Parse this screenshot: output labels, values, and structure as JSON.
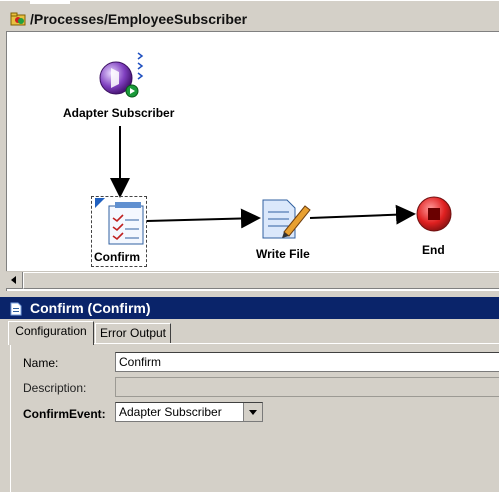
{
  "process": {
    "path": "/Processes/EmployeeSubscriber"
  },
  "canvas": {
    "nodes": [
      {
        "id": "adapter-subscriber",
        "label": "Adapter Subscriber",
        "icon": "adapter-subscriber-icon"
      },
      {
        "id": "confirm",
        "label": "Confirm",
        "icon": "confirm-icon",
        "selected": true
      },
      {
        "id": "write-file",
        "label": "Write File",
        "icon": "write-file-icon"
      },
      {
        "id": "end",
        "label": "End",
        "icon": "end-icon"
      }
    ]
  },
  "panel": {
    "title": "Confirm (Confirm)",
    "tabs": [
      {
        "label": "Configuration",
        "active": true
      },
      {
        "label": "Error Output",
        "active": false
      }
    ],
    "fields": {
      "name": {
        "label": "Name:",
        "value": "Confirm"
      },
      "description": {
        "label": "Description:",
        "value": ""
      },
      "confirm_event": {
        "label": "ConfirmEvent:",
        "value": "Adapter Subscriber"
      }
    }
  },
  "colors": {
    "panel_title_bg": "#0a246a",
    "window_bg": "#d4d0c8",
    "canvas_bg": "#ffffff"
  }
}
